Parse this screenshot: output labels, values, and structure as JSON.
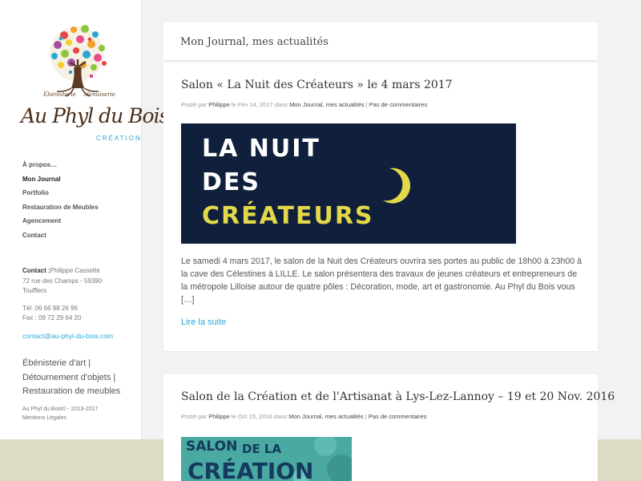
{
  "site": {
    "logo": {
      "left_sub": "Ébénisterie",
      "right_sub": "Menuiserie",
      "brand": "Au Phyl du Bois",
      "tag": "CRÉATION"
    },
    "nav": [
      {
        "label": "À propos…",
        "active": false
      },
      {
        "label": "Mon Journal",
        "active": true
      },
      {
        "label": "Portfolio",
        "active": false
      },
      {
        "label": "Restauration de Meubles",
        "active": false
      },
      {
        "label": "Agencement",
        "active": false
      },
      {
        "label": "Contact",
        "active": false
      }
    ],
    "contact": {
      "label": "Contact :",
      "name": "Philippe Cassette",
      "street": "72 rue des Champs - 59390",
      "city": "Toufflers",
      "tel": "Tél. 06 66 98 26 96",
      "fax": "Fax : 09 72 29 64 20",
      "email": "contact@au-phyl-du-bois.com"
    },
    "tagline": [
      "Ébénisterie d'art |",
      "Détournement d'objets |",
      "Restauration de meubles"
    ],
    "copyright": "Au Phyl du Bois© - 2013-2017",
    "legal": "Mentions Légales"
  },
  "page": {
    "title": "Mon Journal, mes actualités"
  },
  "posts": [
    {
      "title": "Salon « La Nuit des Créateurs » le 4 mars 2017",
      "meta": {
        "by": "Posté par",
        "author": "Philippe",
        "on": "le Fév 14, 2017 dans",
        "category": "Mon Journal, mes actualités",
        "sep": "|",
        "comments": "Pas de commentaires"
      },
      "banner": [
        "LA NUIT",
        "DES",
        "CRÉATEURS"
      ],
      "excerpt": "Le samedi 4 mars 2017, le salon de la Nuit des Créateurs ouvrira ses portes au public de 18h00 à 23h00 à la cave des Célestines à LILLE. Le salon présentera des travaux de jeunes créateurs et entrepreneurs de la métropole Lilloise autour de quatre pôles : Décoration, mode, art et gastronomie. Au Phyl du Bois vous […]",
      "readmore": "Lire la suite"
    },
    {
      "title": "Salon de la Création et de l'Artisanat à Lys-Lez-Lannoy – 19 et 20 Nov. 2016",
      "meta": {
        "by": "Posté par",
        "author": "Philippe",
        "on": "le Oct 15, 2016 dans",
        "category": "Mon Journal, mes actualités",
        "sep": "|",
        "comments": "Pas de commentaires"
      },
      "banner": [
        "SALON",
        "DE LA",
        "CRÉATION"
      ]
    }
  ],
  "colors": {
    "link": "#2aa7d6",
    "banner_navy": "#0f1f3c",
    "banner_yellow": "#e3d84a",
    "banner2_teal": "#4aa9a1",
    "footer_band": "#dcdcc2"
  }
}
